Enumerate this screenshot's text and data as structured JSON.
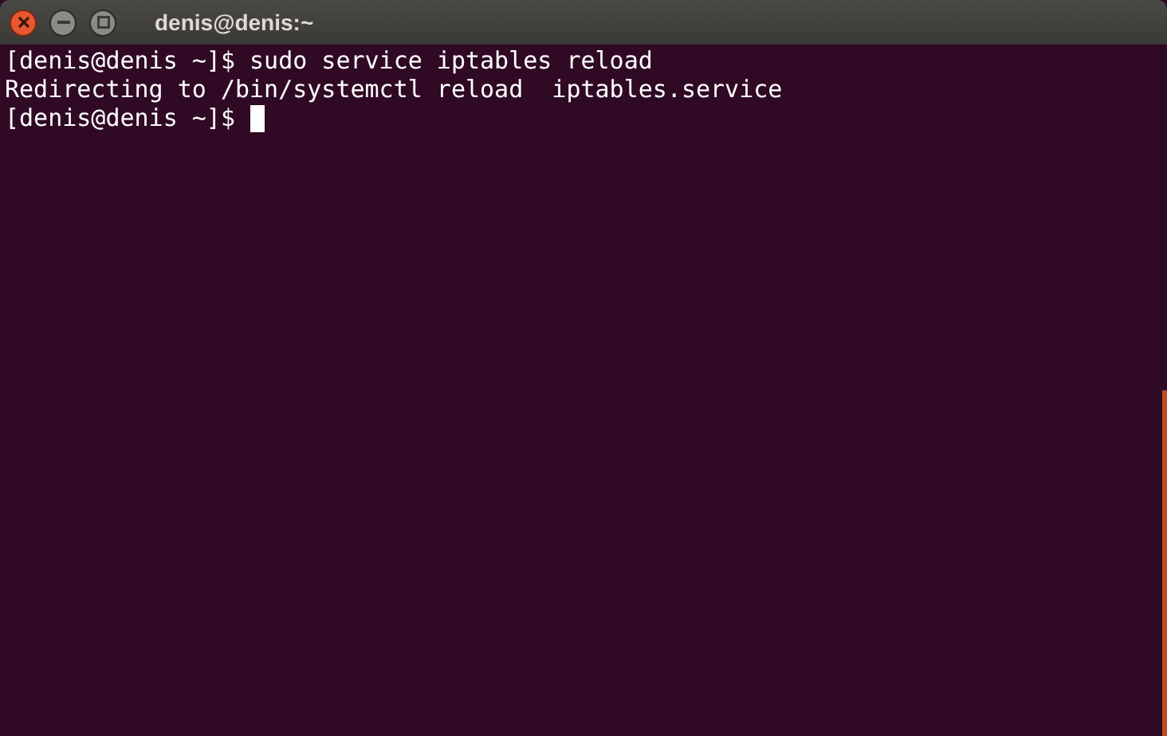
{
  "window": {
    "title": "denis@denis:~"
  },
  "terminal": {
    "lines": [
      {
        "text": "[denis@denis ~]$ sudo service iptables reload",
        "cursor": false
      },
      {
        "text": "Redirecting to /bin/systemctl reload  iptables.service",
        "cursor": false
      },
      {
        "text": "[denis@denis ~]$ ",
        "cursor": true
      }
    ]
  }
}
